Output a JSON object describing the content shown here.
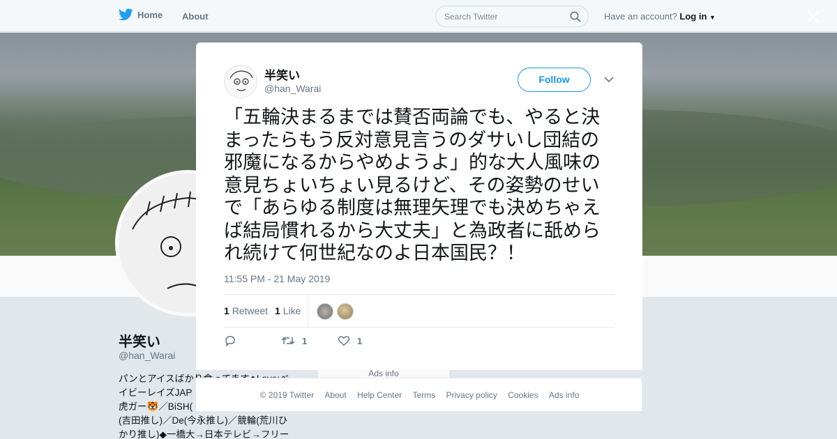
{
  "nav": {
    "home_label": "Home",
    "about_label": "About",
    "search_placeholder": "Search Twitter",
    "account_prompt": "Have an account?",
    "login_label": "Log in"
  },
  "colors": {
    "brand_blue": "#1da1f2",
    "follow_blue": "#1b95e0",
    "muted_text": "#657786"
  },
  "background_profile": {
    "name": "半笑い",
    "handle": "@han_Warai",
    "bio_lines": [
      "パンとアイスばかり食ってます◆Love:ベ",
      "イビーレイズJAP",
      "虎ガー🐯／BiSH(",
      "(吉田推し)／De(今永推し)／競輪(荒川ひ",
      "かり推し)◆一橋大→日本テレビ→フリー"
    ],
    "ads_info_label": "Ads info"
  },
  "tweet": {
    "author_name": "半笑い",
    "author_handle": "@han_Warai",
    "follow_label": "Follow",
    "text_lines": [
      "「五輪決まるまでは賛否両論でも、やると決",
      "まったらもう反対意見言うのダサいし団結の",
      "邪魔になるからやめようよ」的な大人風味の",
      "意見ちょいちょい見るけど、その姿勢のせい",
      "で「あらゆる制度は無理矢理でも決めちゃえ",
      "ば結局慣れるから大丈夫」と為政者に舐めら",
      "れ続けて何世紀なのよ日本国民？！"
    ],
    "timestamp": "11:55 PM - 21 May 2019",
    "retweet_count": "1",
    "retweet_label": "Retweet",
    "like_count": "1",
    "like_label": "Like",
    "action_retweet_count": "1",
    "action_like_count": "1"
  },
  "footer": {
    "links": [
      "© 2019 Twitter",
      "About",
      "Help Center",
      "Terms",
      "Privacy policy",
      "Cookies",
      "Ads info"
    ]
  }
}
